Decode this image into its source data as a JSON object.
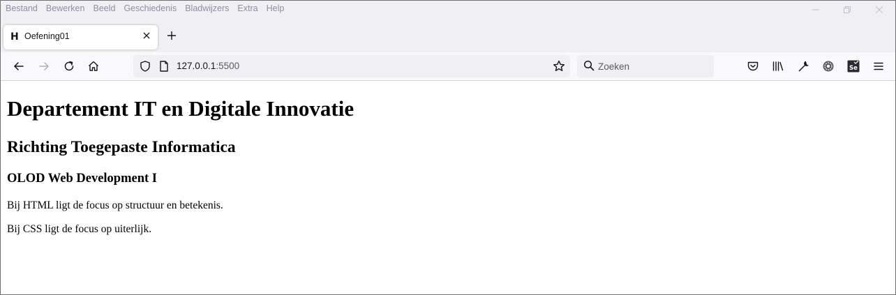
{
  "menubar": {
    "items": [
      "Bestand",
      "Bewerken",
      "Beeld",
      "Geschiedenis",
      "Bladwijzers",
      "Extra",
      "Help"
    ]
  },
  "tab": {
    "favicon": "H",
    "title": "Oefening01",
    "close_icon": "close-icon"
  },
  "newtab_label": "+",
  "nav": {
    "back_icon": "arrow-left-icon",
    "forward_icon": "arrow-right-icon",
    "reload_icon": "reload-icon",
    "home_icon": "home-icon"
  },
  "urlbar": {
    "host": "127.0.0.1",
    "port": ":5500"
  },
  "search": {
    "placeholder": "Zoeken"
  },
  "page": {
    "h1": "Departement IT en Digitale Innovatie",
    "h2": "Richting Toegepaste Informatica",
    "h3": "OLOD Web Development I",
    "paragraphs": [
      "Bij HTML ligt de focus op structuur en betekenis.",
      "Bij CSS ligt de focus op uiterlijk."
    ]
  },
  "colors": {
    "chrome_bg": "#f0f0f4",
    "navbar_bg": "#f9f9fb",
    "text": "#15141a",
    "muted": "#8f8f9d"
  }
}
